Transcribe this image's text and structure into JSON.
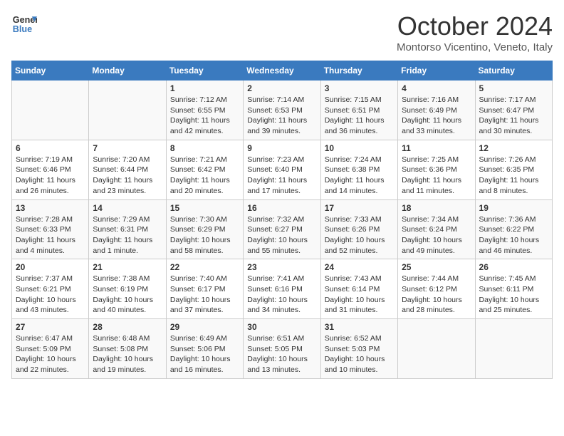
{
  "header": {
    "logo_line1": "General",
    "logo_line2": "Blue",
    "month": "October 2024",
    "location": "Montorso Vicentino, Veneto, Italy"
  },
  "days_of_week": [
    "Sunday",
    "Monday",
    "Tuesday",
    "Wednesday",
    "Thursday",
    "Friday",
    "Saturday"
  ],
  "weeks": [
    [
      {
        "day": "",
        "info": ""
      },
      {
        "day": "",
        "info": ""
      },
      {
        "day": "1",
        "info": "Sunrise: 7:12 AM\nSunset: 6:55 PM\nDaylight: 11 hours and 42 minutes."
      },
      {
        "day": "2",
        "info": "Sunrise: 7:14 AM\nSunset: 6:53 PM\nDaylight: 11 hours and 39 minutes."
      },
      {
        "day": "3",
        "info": "Sunrise: 7:15 AM\nSunset: 6:51 PM\nDaylight: 11 hours and 36 minutes."
      },
      {
        "day": "4",
        "info": "Sunrise: 7:16 AM\nSunset: 6:49 PM\nDaylight: 11 hours and 33 minutes."
      },
      {
        "day": "5",
        "info": "Sunrise: 7:17 AM\nSunset: 6:47 PM\nDaylight: 11 hours and 30 minutes."
      }
    ],
    [
      {
        "day": "6",
        "info": "Sunrise: 7:19 AM\nSunset: 6:46 PM\nDaylight: 11 hours and 26 minutes."
      },
      {
        "day": "7",
        "info": "Sunrise: 7:20 AM\nSunset: 6:44 PM\nDaylight: 11 hours and 23 minutes."
      },
      {
        "day": "8",
        "info": "Sunrise: 7:21 AM\nSunset: 6:42 PM\nDaylight: 11 hours and 20 minutes."
      },
      {
        "day": "9",
        "info": "Sunrise: 7:23 AM\nSunset: 6:40 PM\nDaylight: 11 hours and 17 minutes."
      },
      {
        "day": "10",
        "info": "Sunrise: 7:24 AM\nSunset: 6:38 PM\nDaylight: 11 hours and 14 minutes."
      },
      {
        "day": "11",
        "info": "Sunrise: 7:25 AM\nSunset: 6:36 PM\nDaylight: 11 hours and 11 minutes."
      },
      {
        "day": "12",
        "info": "Sunrise: 7:26 AM\nSunset: 6:35 PM\nDaylight: 11 hours and 8 minutes."
      }
    ],
    [
      {
        "day": "13",
        "info": "Sunrise: 7:28 AM\nSunset: 6:33 PM\nDaylight: 11 hours and 4 minutes."
      },
      {
        "day": "14",
        "info": "Sunrise: 7:29 AM\nSunset: 6:31 PM\nDaylight: 11 hours and 1 minute."
      },
      {
        "day": "15",
        "info": "Sunrise: 7:30 AM\nSunset: 6:29 PM\nDaylight: 10 hours and 58 minutes."
      },
      {
        "day": "16",
        "info": "Sunrise: 7:32 AM\nSunset: 6:27 PM\nDaylight: 10 hours and 55 minutes."
      },
      {
        "day": "17",
        "info": "Sunrise: 7:33 AM\nSunset: 6:26 PM\nDaylight: 10 hours and 52 minutes."
      },
      {
        "day": "18",
        "info": "Sunrise: 7:34 AM\nSunset: 6:24 PM\nDaylight: 10 hours and 49 minutes."
      },
      {
        "day": "19",
        "info": "Sunrise: 7:36 AM\nSunset: 6:22 PM\nDaylight: 10 hours and 46 minutes."
      }
    ],
    [
      {
        "day": "20",
        "info": "Sunrise: 7:37 AM\nSunset: 6:21 PM\nDaylight: 10 hours and 43 minutes."
      },
      {
        "day": "21",
        "info": "Sunrise: 7:38 AM\nSunset: 6:19 PM\nDaylight: 10 hours and 40 minutes."
      },
      {
        "day": "22",
        "info": "Sunrise: 7:40 AM\nSunset: 6:17 PM\nDaylight: 10 hours and 37 minutes."
      },
      {
        "day": "23",
        "info": "Sunrise: 7:41 AM\nSunset: 6:16 PM\nDaylight: 10 hours and 34 minutes."
      },
      {
        "day": "24",
        "info": "Sunrise: 7:43 AM\nSunset: 6:14 PM\nDaylight: 10 hours and 31 minutes."
      },
      {
        "day": "25",
        "info": "Sunrise: 7:44 AM\nSunset: 6:12 PM\nDaylight: 10 hours and 28 minutes."
      },
      {
        "day": "26",
        "info": "Sunrise: 7:45 AM\nSunset: 6:11 PM\nDaylight: 10 hours and 25 minutes."
      }
    ],
    [
      {
        "day": "27",
        "info": "Sunrise: 6:47 AM\nSunset: 5:09 PM\nDaylight: 10 hours and 22 minutes."
      },
      {
        "day": "28",
        "info": "Sunrise: 6:48 AM\nSunset: 5:08 PM\nDaylight: 10 hours and 19 minutes."
      },
      {
        "day": "29",
        "info": "Sunrise: 6:49 AM\nSunset: 5:06 PM\nDaylight: 10 hours and 16 minutes."
      },
      {
        "day": "30",
        "info": "Sunrise: 6:51 AM\nSunset: 5:05 PM\nDaylight: 10 hours and 13 minutes."
      },
      {
        "day": "31",
        "info": "Sunrise: 6:52 AM\nSunset: 5:03 PM\nDaylight: 10 hours and 10 minutes."
      },
      {
        "day": "",
        "info": ""
      },
      {
        "day": "",
        "info": ""
      }
    ]
  ]
}
